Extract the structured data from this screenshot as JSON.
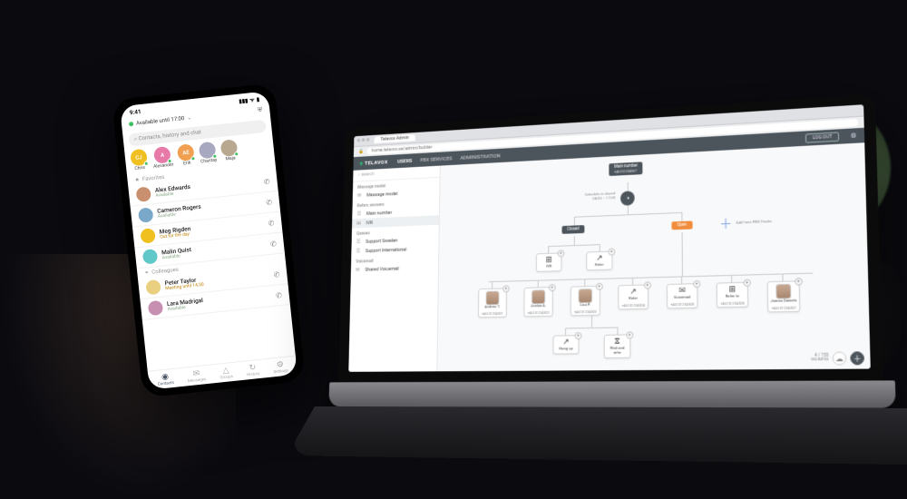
{
  "phone": {
    "status_time": "9:41",
    "presence_label": "Available until 17:00",
    "search_placeholder": "Contacts, history and chat",
    "quick_avatars": [
      {
        "initials": "CJ",
        "name": "Chris",
        "cls": "c-yel"
      },
      {
        "initials": "A",
        "name": "Alexander",
        "cls": "c-pink"
      },
      {
        "initials": "AE",
        "name": "Erik",
        "cls": "c-orng"
      },
      {
        "initials": "",
        "name": "Chantay",
        "cls": "c-ph1"
      },
      {
        "initials": "",
        "name": "Maja",
        "cls": "c-ph2"
      }
    ],
    "section_fav": "Favorites",
    "section_col": "Colleagues",
    "contacts": [
      {
        "name": "Alex Edwards",
        "sub": "Available",
        "busy": false,
        "bg": "#c8906e"
      },
      {
        "name": "Cameron Rogers",
        "sub": "Available",
        "busy": false,
        "bg": "#7aa8c8"
      },
      {
        "name": "Meg Rigden",
        "sub": "Out for the day",
        "busy": true,
        "bg": "#f0c020"
      },
      {
        "name": "Malin Quist",
        "sub": "Available",
        "busy": false,
        "bg": "#60c8c8"
      },
      {
        "name": "Peter Taylor",
        "sub": "Meeting until 14:30",
        "busy": true,
        "bg": "#e8d080"
      },
      {
        "name": "Lara Madrigal",
        "sub": "Available",
        "busy": false,
        "bg": "#c890b0"
      }
    ],
    "tabs": [
      {
        "label": "Contacts",
        "icon": "◉",
        "active": true
      },
      {
        "label": "Messages",
        "icon": "✉",
        "active": false
      },
      {
        "label": "Groups",
        "icon": "△",
        "active": false
      },
      {
        "label": "History",
        "icon": "↻",
        "active": false
      },
      {
        "label": "Settings",
        "icon": "⚙",
        "active": false
      }
    ]
  },
  "laptop": {
    "browser_tab": "Telavox Admin",
    "url": "home.telavox.se/admin/builder",
    "brand": "TELAVOX",
    "nav": {
      "users": "USERS",
      "pbx": "PBX SERVICES",
      "admin": "ADMINISTRATION"
    },
    "logout": "LOG OUT",
    "sidebar": {
      "search_placeholder": "search",
      "groups": [
        {
          "title": "Message model",
          "items": [
            {
              "icon": "✉",
              "label": "Message model",
              "sel": false
            }
          ]
        },
        {
          "title": "Refers answers",
          "items": [
            {
              "icon": "☰",
              "label": "Main number",
              "sel": false
            },
            {
              "icon": "⊞",
              "label": "IVR",
              "sel": true
            }
          ]
        },
        {
          "title": "Queues",
          "items": [
            {
              "icon": "☰",
              "label": "Support Sweden",
              "sel": false
            },
            {
              "icon": "☰",
              "label": "Support International",
              "sel": false
            }
          ]
        },
        {
          "title": "Voicemail",
          "items": [
            {
              "icon": "✉",
              "label": "Shared Voicemail",
              "sel": false
            }
          ]
        }
      ]
    },
    "flow": {
      "top_chip": "Main number",
      "top_number": "+46101234567",
      "clock_open_text": "Schedule is closed",
      "clock_open_value": "08:00 – 17:00",
      "chip_closed": "Closed",
      "chip_open": "Open",
      "add_label": "Add here PBX Finder",
      "row_closed": [
        {
          "icon": "⊞",
          "label": "IVR",
          "number": ""
        },
        {
          "icon": "↗",
          "label": "Refer",
          "number": ""
        }
      ],
      "row_open": [
        {
          "icon": "av",
          "label": "Andrew T.",
          "number": "+46101234501"
        },
        {
          "icon": "av",
          "label": "Jordan A.",
          "number": "+46101234502"
        },
        {
          "icon": "av",
          "label": "Lisa P.",
          "number": "+46101234503"
        },
        {
          "icon": "↗",
          "label": "Refer",
          "number": "+46101234504"
        },
        {
          "icon": "✉",
          "label": "Voicemail",
          "number": "+46101234505"
        },
        {
          "icon": "⊞",
          "label": "Refer to",
          "number": "+46101234506"
        },
        {
          "icon": "av",
          "label": "James Daniels",
          "number": "+46101234507"
        }
      ],
      "row_bottom": [
        {
          "icon": "↗",
          "label": "Hang up",
          "number": ""
        },
        {
          "icon": "⧖",
          "label": "Wait and refer",
          "number": ""
        }
      ]
    },
    "footer": {
      "counter": "4 / 150",
      "sub": "UNLIMITED"
    }
  }
}
